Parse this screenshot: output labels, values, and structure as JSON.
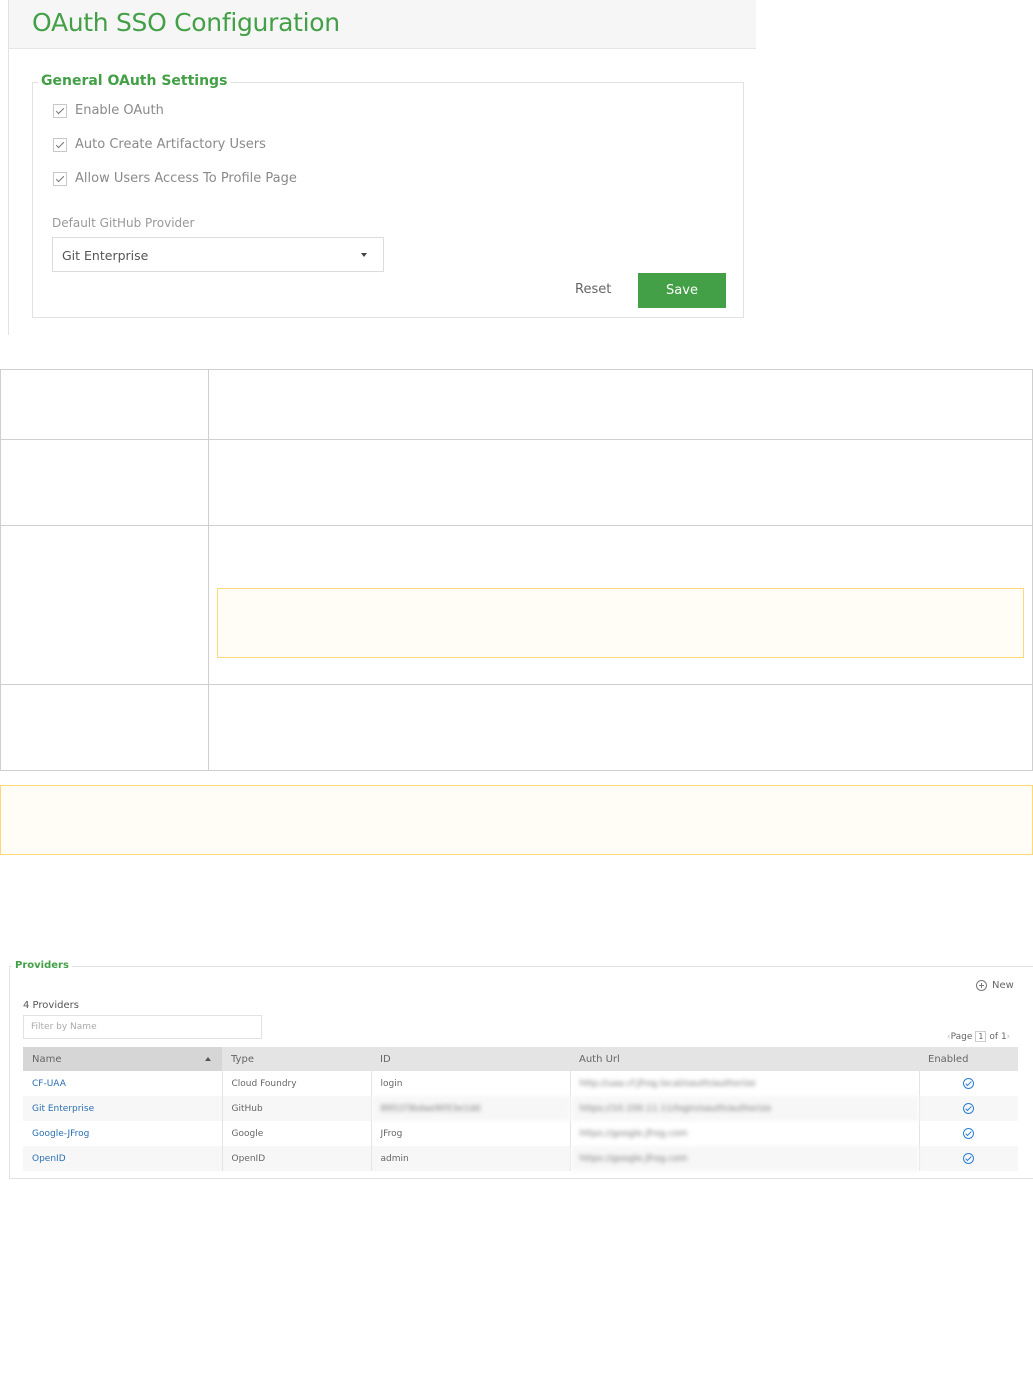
{
  "header": {
    "title": "OAuth SSO Configuration"
  },
  "general_settings": {
    "legend": "General OAuth Settings",
    "checkboxes": [
      {
        "label": "Enable OAuth",
        "checked": true
      },
      {
        "label": "Auto Create Artifactory Users",
        "checked": true
      },
      {
        "label": "Allow Users Access To Profile Page",
        "checked": true
      }
    ],
    "default_provider_label": "Default GitHub Provider",
    "default_provider_value": "Git Enterprise",
    "reset_label": "Reset",
    "save_label": "Save"
  },
  "providers": {
    "legend": "Providers",
    "new_label": "New",
    "count_text": "4 Providers",
    "filter_placeholder": "Filter by Name",
    "pager": {
      "page_label": "Page",
      "current": "1",
      "of_label": "of 1"
    },
    "columns": [
      "Name",
      "Type",
      "ID",
      "Auth Url",
      "Enabled"
    ],
    "rows": [
      {
        "name": "CF-UAA",
        "type": "Cloud Foundry",
        "id": "login",
        "auth_url": "http://uaa.cf.jfrog.local/oauth/authorize",
        "enabled": true
      },
      {
        "name": "Git Enterprise",
        "type": "GitHub",
        "id": "8951f3bdae9053e1dd",
        "auth_url": "https://10.100.11.11/login/oauth/authorize",
        "enabled": true
      },
      {
        "name": "Google-JFrog",
        "type": "Google",
        "id": "JFrog",
        "auth_url": "https://google.jfrog.com",
        "enabled": true
      },
      {
        "name": "OpenID",
        "type": "OpenID",
        "id": "admin",
        "auth_url": "https://google.jfrog.com",
        "enabled": true
      }
    ]
  },
  "colors": {
    "accent": "#43a047",
    "link": "#2a6fb3",
    "note_border": "#ffd87a"
  },
  "icons": {
    "new": "plus-circle-icon",
    "enabled": "check-circle-icon",
    "dropdown": "caret-down-icon",
    "sort": "sort-asc-icon"
  }
}
